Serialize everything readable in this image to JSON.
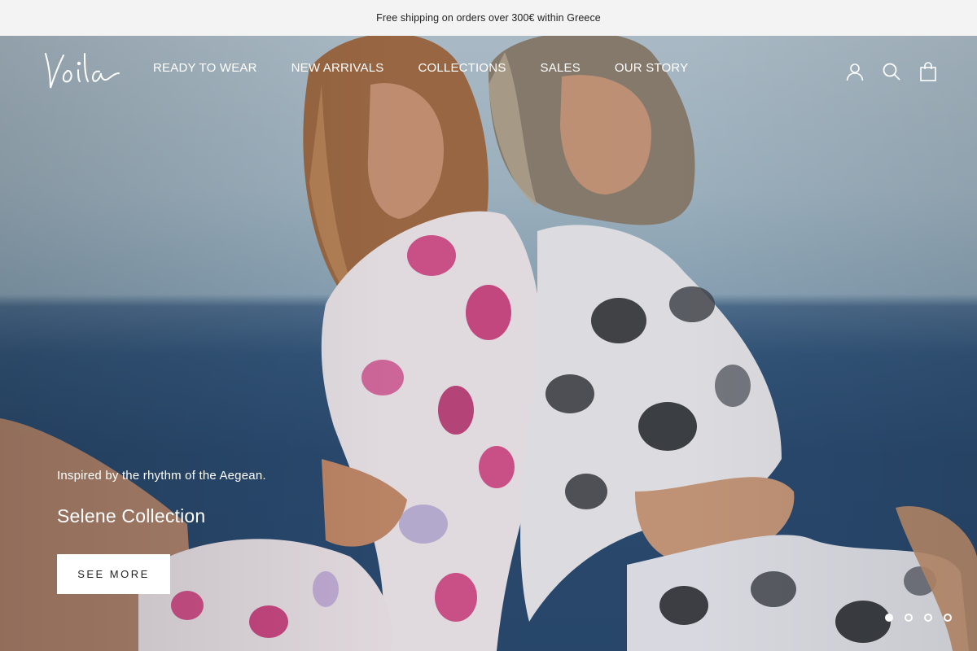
{
  "announcement": {
    "text": "Free shipping on orders over 300€ within Greece"
  },
  "header": {
    "logo_text": "Voila",
    "nav": [
      {
        "label": "READY TO WEAR"
      },
      {
        "label": "NEW ARRIVALS"
      },
      {
        "label": "COLLECTIONS"
      },
      {
        "label": "SALES"
      },
      {
        "label": "OUR STORY"
      }
    ],
    "icons": [
      "account-icon",
      "search-icon",
      "cart-icon"
    ]
  },
  "hero": {
    "subtitle": "Inspired by the rhythm of the Aegean.",
    "title": "Selene Collection",
    "button_label": "SEE MORE",
    "slides_total": 4,
    "active_slide": 1
  },
  "colors": {
    "announcement_bg": "#f3f3f3",
    "sky": "#a8bccb",
    "sea": "#2b4c72",
    "button_bg": "#ffffff",
    "text_light": "#ffffff"
  }
}
